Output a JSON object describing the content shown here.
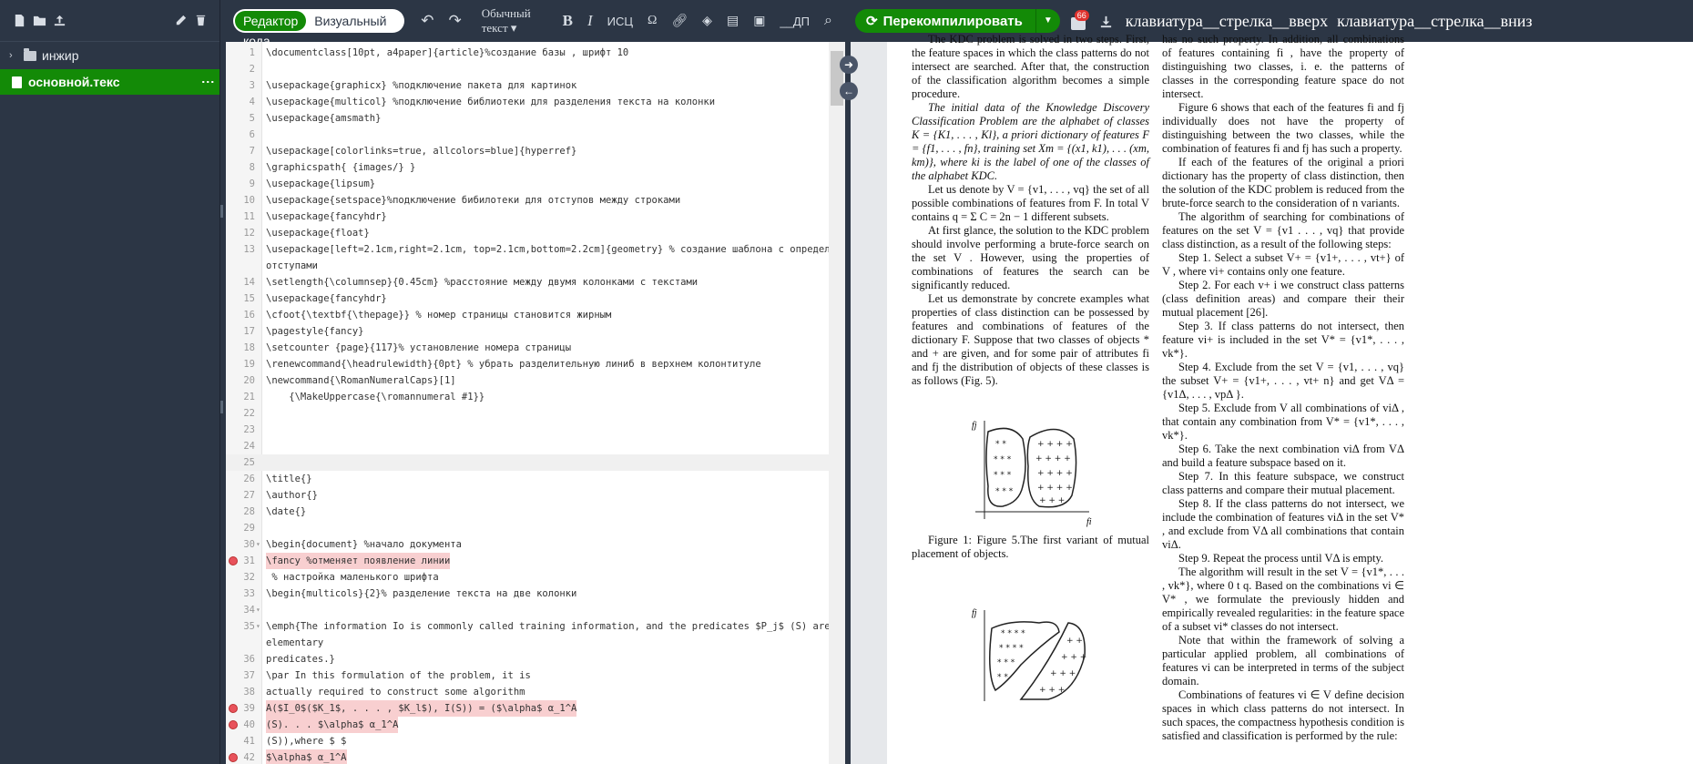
{
  "sidebar": {
    "folder": "инжир",
    "file": "основной.текс"
  },
  "editor_toolbar": {
    "mode_code": "Редактор кода",
    "mode_visual": "Визуальный редактор",
    "style_select": "Обычный текст",
    "bold": "B",
    "italic": "I",
    "smallcaps": "ИСЦ",
    "omega": "Ω",
    "more": "__ДП"
  },
  "code_lines": [
    {
      "n": "1",
      "t": "\\documentclass[10pt, a4paper]{article}%создание базы , шрифт 10"
    },
    {
      "n": "2",
      "t": ""
    },
    {
      "n": "3",
      "t": "\\usepackage{graphicx} %подключение пакета для картинок"
    },
    {
      "n": "4",
      "t": "\\usepackage{multicol} %подключение библиотеки для разделения текста на колонки"
    },
    {
      "n": "5",
      "t": "\\usepackage{amsmath}"
    },
    {
      "n": "6",
      "t": ""
    },
    {
      "n": "7",
      "t": "\\usepackage[colorlinks=true, allcolors=blue]{hyperref}"
    },
    {
      "n": "8",
      "t": "\\graphicspath{ {images/} }"
    },
    {
      "n": "9",
      "t": "\\usepackage{lipsum}"
    },
    {
      "n": "10",
      "t": "\\usepackage{setspace}%подключение бибилотеки для отступов между строками"
    },
    {
      "n": "11",
      "t": "\\usepackage{fancyhdr}"
    },
    {
      "n": "12",
      "t": "\\usepackage{float}"
    },
    {
      "n": "13",
      "t": "\\usepackage[left=2.1cm,right=2.1cm, top=2.1cm,bottom=2.2cm]{geometry} % создание шаблона с определенными"
    },
    {
      "n": "",
      "t": "отступами"
    },
    {
      "n": "14",
      "t": "\\setlength{\\columnsep}{0.45cm} %расстояние между двумя колонками с текстами"
    },
    {
      "n": "15",
      "t": "\\usepackage{fancyhdr}"
    },
    {
      "n": "16",
      "t": "\\cfoot{\\textbf{\\thepage}} % номер страницы становится жирным"
    },
    {
      "n": "17",
      "t": "\\pagestyle{fancy}"
    },
    {
      "n": "18",
      "t": "\\setcounter {page}{117}% установление номера страницы"
    },
    {
      "n": "19",
      "t": "\\renewcommand{\\headrulewidth}{0pt} % убрать разделительную линиб в верхнем колонтитуле"
    },
    {
      "n": "20",
      "t": "\\newcommand{\\RomanNumeralCaps}[1]"
    },
    {
      "n": "21",
      "t": "    {\\MakeUppercase{\\romannumeral #1}}"
    },
    {
      "n": "22",
      "t": ""
    },
    {
      "n": "23",
      "t": ""
    },
    {
      "n": "24",
      "t": ""
    },
    {
      "n": "25",
      "t": ""
    },
    {
      "n": "26",
      "t": "\\title{}"
    },
    {
      "n": "27",
      "t": "\\author{}"
    },
    {
      "n": "28",
      "t": "\\date{}"
    },
    {
      "n": "29",
      "t": ""
    },
    {
      "n": "30",
      "t": "\\begin{document} %начало документа"
    },
    {
      "n": "31",
      "t": "\\fancy %отменяет появление линии"
    },
    {
      "n": "32",
      "t": " % настройка маленького шрифта"
    },
    {
      "n": "33",
      "t": "\\begin{multicols}{2}% разделение текста на две колонки"
    },
    {
      "n": "34",
      "t": ""
    },
    {
      "n": "35",
      "t": "\\emph{The information Io is commonly called training information, and the predicates $P_j$ (S) are called"
    },
    {
      "n": "",
      "t": "elementary"
    },
    {
      "n": "36",
      "t": "predicates.}"
    },
    {
      "n": "37",
      "t": "\\par In this formulation of the problem, it is"
    },
    {
      "n": "38",
      "t": "actually required to construct some algorithm"
    },
    {
      "n": "39",
      "t": "A($I_0$($K_1$, . . . , $K_l$), I(S)) = ($\\alpha$ α_1^A"
    },
    {
      "n": "40",
      "t": "(S). . . $\\alpha$ α_1^A"
    },
    {
      "n": "41",
      "t": "(S)),where $ $"
    },
    {
      "n": "42",
      "t": "$\\alpha$ α_1^A"
    }
  ],
  "pdf_toolbar": {
    "recompile": "Перекомпилировать",
    "badge": "66",
    "kbd1": "клавиатура__стрелка__вверх",
    "kbd2": "клавиатура__стрелка__вниз"
  },
  "pdf_left": [
    "The KDC problem is solved in two steps. First, the feature spaces in which the class patterns do not intersect are searched. After that, the construction of the classification algorithm becomes a simple procedure.",
    "The initial data of the Knowledge Discovery Classification Problem are the alphabet of classes K = {K1, . . . , Kl}, a priori dictionary of features F = {f1, . . . , fn}, training set Xm = {(x1, k1), . . . (xm, km)}, where ki is the label of one of the classes of the alphabet KDC.",
    "Let us denote by V = {v1, . . . , vq} the set of all possible combinations of features from F. In total V contains q = Σ C = 2n − 1 different subsets.",
    "At first glance, the solution to the KDC problem should involve performing a brute-force search on the set V . However, using the properties of combinations of features the search can be significantly reduced.",
    "Let us demonstrate by concrete examples what properties of class distinction can be possessed by features and combinations of features of the dictionary F. Suppose that two classes of objects * and + are given, and for some pair of attributes fi and fj the distribution of objects of these classes is as follows (Fig. 5)."
  ],
  "pdf_caption": "Figure 1: Figure 5.The first variant of mutual placement of objects.",
  "pdf_right": [
    "has no such property. In addition, all combinations of features containing fi , have the property of distinguishing two classes, i. e. the patterns of classes in the corresponding feature space do not intersect.",
    "Figure 6 shows that each of the features fi and fj individually does not have the property of distinguishing between the two classes, while the combination of features fi and fj has such a property.",
    "If each of the features of the original a priori dictionary has the property of class distinction, then the solution of the KDC problem is reduced from the brute-force search to the consideration of n variants.",
    "The algorithm of searching for combinations of features on the set V = {v1 . . . , vq} that provide class distinction, as a result of the following steps:",
    "Step 1. Select a subset V+ = {v1+, . . . , vt+} of V , where vi+ contains only one feature.",
    "Step 2. For each v+ i we construct class patterns (class definition areas) and compare their their mutual placement [26].",
    "Step 3. If class patterns do not intersect, then feature vi+ is included in the set V* = {v1*, . . . , vk*}.",
    "Step 4. Exclude from the set V = {v1, . . . , vq} the subset V+ = {v1+, . . . , vt+ n} and get VΔ = {v1Δ, . . . , vpΔ }.",
    "Step 5. Exclude from V all combinations of viΔ , that contain any combination from V* = {v1*, . . . , vk*}.",
    "Step 6. Take the next combination viΔ from VΔ and build a feature subspace based on it.",
    "Step 7. In this feature subspace, we construct class patterns and compare their mutual placement.",
    "Step 8. If the class patterns do not intersect, we include the combination of features viΔ in the set V* , and exclude from VΔ all combinations that contain viΔ.",
    "Step 9. Repeat the process until VΔ is empty.",
    "The algorithm will result in the set V = {v1*, . . . , vk*}, where 0 t q. Based on the combinations vi ∈ V* , we formulate the previously hidden and empirically revealed regularities: in the feature space of a subset vi* classes do not intersect.",
    "Note that within the framework of solving a particular applied problem, all combinations of features vi can be interpreted in terms of the subject domain.",
    "Combinations of features vi ∈ V define decision spaces in which class patterns do not intersect. In such spaces, the compactness hypothesis condition is satisfied and classification is performed by the rule:"
  ],
  "fig_labels": {
    "fj": "fj",
    "fi": "fi"
  }
}
